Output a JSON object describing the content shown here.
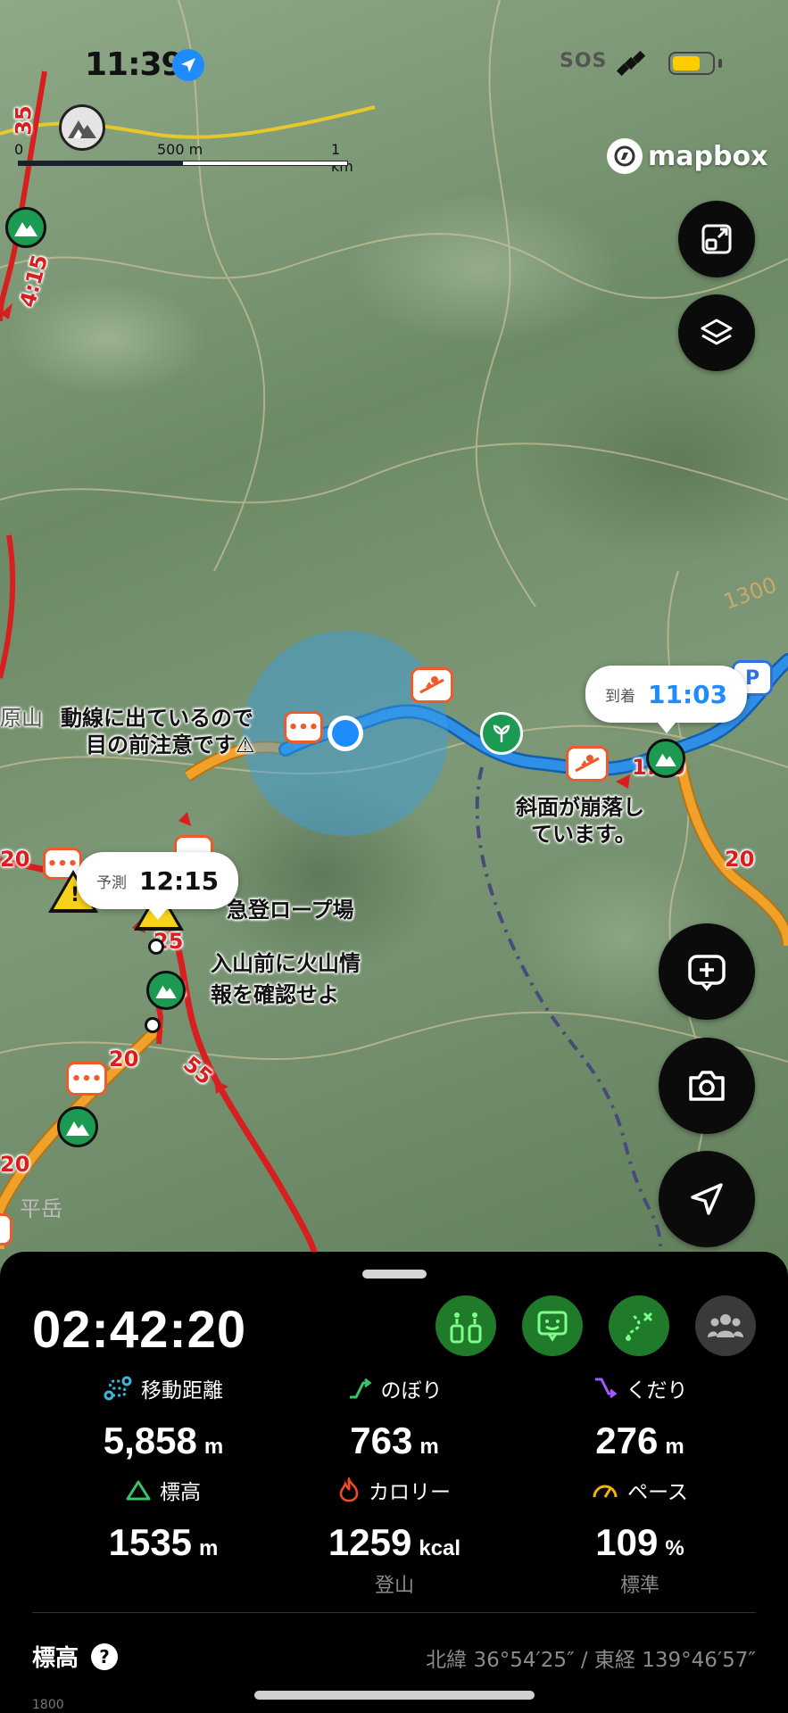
{
  "status_bar": {
    "time": "11:39",
    "sos": "SOS",
    "battery_level_percent": 60,
    "accent": "#1e8bff"
  },
  "map": {
    "provider_logo": "mapbox",
    "scale": {
      "labels": [
        "0",
        "500 m",
        "1 km"
      ]
    },
    "annotations": {
      "notice_1": "動線に出ているので",
      "notice_2": "目の前注意です⚠",
      "slope_1": "斜面が崩落し",
      "slope_2": "ています。",
      "rope": "急登ロープ場",
      "volcano_1": "入山前に火山情",
      "volcano_2": "報を確認せよ",
      "contour": "1300",
      "peak": "平岳",
      "left_char": "原山"
    },
    "route_times": [
      "35",
      "4:15",
      "1:20",
      "20",
      "55",
      "20",
      "20",
      "20",
      "25",
      "4"
    ],
    "arrival_bubble": {
      "label": "到着",
      "time": "11:03"
    },
    "forecast_bubble": {
      "label": "予測",
      "time": "12:15"
    },
    "colors": {
      "route": "#2f8fe6",
      "trail": "#d81f1f",
      "road": "#f0a12a",
      "location": "#1e8bff"
    }
  },
  "map_controls": {
    "fit_icon": "fit-route-icon",
    "layers_icon": "layers-icon",
    "add_memo_icon": "add-memo-icon",
    "camera_icon": "camera-icon",
    "navigate_icon": "navigate-arrow-icon"
  },
  "sheet": {
    "elapsed_time": "02:42:20",
    "actions": [
      "checkpoint-icon",
      "report-icon",
      "route-off-icon",
      "group-icon"
    ],
    "stats": {
      "distance": {
        "label": "移動距離",
        "value": "5,858",
        "unit": "m"
      },
      "ascent": {
        "label": "のぼり",
        "value": "763",
        "unit": "m"
      },
      "descent": {
        "label": "くだり",
        "value": "276",
        "unit": "m"
      },
      "elevation": {
        "label": "標高",
        "value": "1535",
        "unit": "m"
      },
      "calories": {
        "label": "カロリー",
        "value": "1259",
        "unit": "kcal",
        "sub": "登山"
      },
      "pace": {
        "label": "ペース",
        "value": "109",
        "unit": "%",
        "sub": "標準"
      }
    },
    "elevation_section": {
      "title": "標高",
      "help": "?",
      "coordinates": "北緯 36°54′25″ / 東経 139°46′57″",
      "chart_stub": "1800"
    },
    "colors": {
      "distance_icon": "#3ab7d8",
      "ascent_icon": "#39c46b",
      "descent_icon": "#a259ff",
      "elevation_icon": "#39c46b",
      "calorie_icon": "#f04a2a",
      "pace_icon": "#f5b400"
    }
  }
}
